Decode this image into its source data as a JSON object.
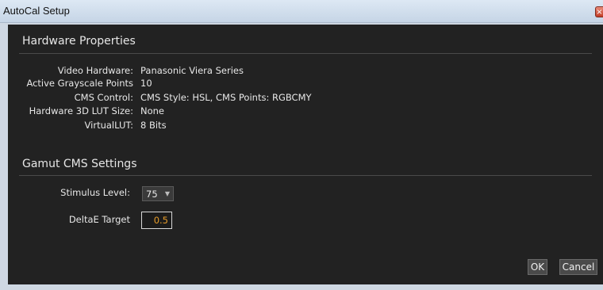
{
  "window": {
    "title": "AutoCal Setup",
    "close_glyph": "×"
  },
  "hardware": {
    "section_title": "Hardware Properties",
    "rows": [
      {
        "label": "Video Hardware:",
        "value": "Panasonic Viera Series"
      },
      {
        "label": "Active Grayscale Points",
        "value": "10"
      },
      {
        "label": "CMS Control:",
        "value": "CMS Style: HSL, CMS Points: RGBCMY"
      },
      {
        "label": "Hardware 3D LUT Size:",
        "value": "None"
      },
      {
        "label": "VirtualLUT:",
        "value": "8 Bits"
      }
    ]
  },
  "gamut": {
    "section_title": "Gamut CMS Settings",
    "stimulus_label": "Stimulus Level:",
    "stimulus_value": "75",
    "deltae_label": "DeltaE Target",
    "deltae_value": "0.5"
  },
  "buttons": {
    "ok": "OK",
    "cancel": "Cancel"
  },
  "colors": {
    "panel_bg": "#222222",
    "accent_value": "#e59b2a"
  }
}
